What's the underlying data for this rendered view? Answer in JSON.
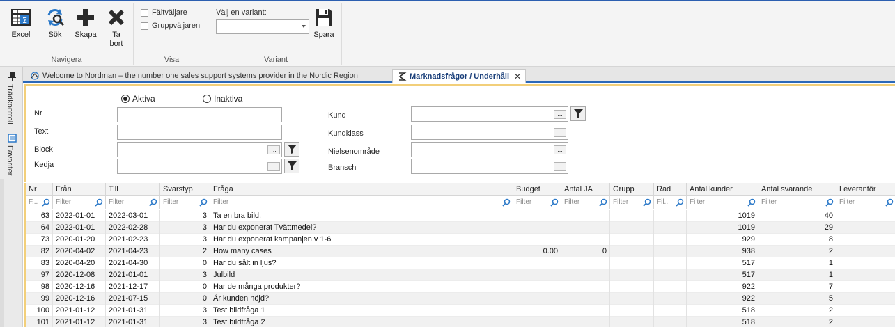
{
  "ribbon": {
    "navigera": {
      "label": "Navigera",
      "buttons": [
        {
          "id": "excel",
          "label": "Excel"
        },
        {
          "id": "sok",
          "label": "Sök"
        },
        {
          "id": "skapa",
          "label": "Skapa"
        },
        {
          "id": "tabort",
          "label": "Ta bort"
        }
      ]
    },
    "visa": {
      "label": "Visa",
      "checkboxes": [
        "Fältväljare",
        "Gruppväljaren"
      ]
    },
    "variant": {
      "label": "Variant",
      "select_label": "Välj en variant:",
      "select_value": "",
      "save_label": "Spara"
    }
  },
  "side_tabs": [
    "Trädkontroll",
    "Favoriter"
  ],
  "doc_tabs": [
    {
      "label": "Welcome to Nordman – the number one sales support systems provider in the Nordic Region",
      "active": false
    },
    {
      "label": "Marknadsfrågor / Underhåll",
      "active": true
    }
  ],
  "form": {
    "radios": [
      {
        "label": "Aktiva",
        "selected": true
      },
      {
        "label": "Inaktiva",
        "selected": false
      }
    ],
    "left_fields": [
      {
        "label": "Nr",
        "value": ""
      },
      {
        "label": "Text",
        "value": ""
      },
      {
        "label": "Block",
        "value": ""
      },
      {
        "label": "Kedja",
        "value": ""
      }
    ],
    "right_fields": [
      {
        "label": "Kund",
        "value": ""
      },
      {
        "label": "Kundklass",
        "value": ""
      },
      {
        "label": "Nielsenområde",
        "value": ""
      },
      {
        "label": "Bransch",
        "value": ""
      }
    ],
    "lookup_button": "..."
  },
  "grid": {
    "columns": [
      "Nr",
      "Från",
      "Till",
      "Svarstyp",
      "Fråga",
      "Budget",
      "Antal JA",
      "Grupp",
      "Rad",
      "Antal kunder",
      "Antal svarande",
      "Leverantör"
    ],
    "filter_placeholders": [
      "F...",
      "Filter",
      "Filter",
      "Filter",
      "Filter",
      "Filter",
      "Filter",
      "Filter",
      "Fil...",
      "Filter",
      "Filter",
      "Filter"
    ],
    "rows": [
      [
        "63",
        "2022-01-01",
        "2022-03-01",
        "3",
        "Ta en bra bild.",
        "",
        "",
        "",
        "",
        "1019",
        "40",
        ""
      ],
      [
        "64",
        "2022-01-01",
        "2022-02-28",
        "3",
        "Har du exponerat Tvättmedel?",
        "",
        "",
        "",
        "",
        "1019",
        "29",
        ""
      ],
      [
        "73",
        "2020-01-20",
        "2021-02-23",
        "3",
        "Har du exponerat kampanjen v 1-6",
        "",
        "",
        "",
        "",
        "929",
        "8",
        ""
      ],
      [
        "82",
        "2020-04-02",
        "2021-04-23",
        "2",
        "How many cases",
        "0.00",
        "0",
        "",
        "",
        "938",
        "2",
        ""
      ],
      [
        "83",
        "2020-04-20",
        "2021-04-30",
        "0",
        "Har du sålt in ljus?",
        "",
        "",
        "",
        "",
        "517",
        "1",
        ""
      ],
      [
        "97",
        "2020-12-08",
        "2021-01-01",
        "3",
        "Julbild",
        "",
        "",
        "",
        "",
        "517",
        "1",
        ""
      ],
      [
        "98",
        "2020-12-16",
        "2021-12-17",
        "0",
        "Har de många produkter?",
        "",
        "",
        "",
        "",
        "922",
        "7",
        ""
      ],
      [
        "99",
        "2020-12-16",
        "2021-07-15",
        "0",
        "Är kunden nöjd?",
        "",
        "",
        "",
        "",
        "922",
        "5",
        ""
      ],
      [
        "100",
        "2021-01-12",
        "2021-01-31",
        "3",
        "Test bildfråga 1",
        "",
        "",
        "",
        "",
        "518",
        "2",
        ""
      ],
      [
        "101",
        "2021-01-12",
        "2021-01-31",
        "3",
        "Test bildfråga 2",
        "",
        "",
        "",
        "",
        "518",
        "2",
        ""
      ]
    ]
  },
  "colors": {
    "accent": "#2c5fb0",
    "form_border": "#f2cf7a",
    "icon_blue": "#2a78c8",
    "icon_dark": "#2b2b2b"
  }
}
